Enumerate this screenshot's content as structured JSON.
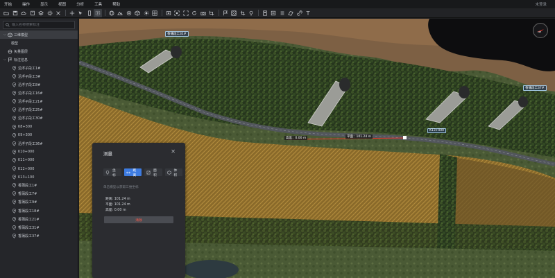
{
  "menubar": {
    "items": [
      "开始",
      "操作",
      "显示",
      "视图",
      "分析",
      "工具",
      "帮助"
    ],
    "login": "未登录"
  },
  "toolbar": {
    "icons": [
      "folder-icon",
      "save-icon",
      "cloud-icon",
      "settings-icon",
      "layers-icon",
      "gear-icon",
      "close-icon",
      "move-icon",
      "select-icon",
      "ruler-icon",
      "select-box-icon",
      "globe-icon",
      "terrain-icon",
      "target-icon",
      "cube-icon",
      "sun-icon",
      "grid-icon",
      "frame-icon",
      "zoom-fit-icon",
      "fullscreen-icon",
      "rotate-icon",
      "camera-icon",
      "screenshot-icon",
      "flag-icon",
      "pattern-icon",
      "crop-icon",
      "pin-icon",
      "book-icon",
      "archive-icon",
      "list-icon",
      "transform-icon",
      "link-icon",
      "text-icon"
    ]
  },
  "sidebar": {
    "search_placeholder": "输入名称搜索标注",
    "tree": [
      {
        "label": "三维模型",
        "level": 0,
        "caret": "⌵",
        "icon": "model-icon",
        "selected": true
      },
      {
        "label": "模型",
        "level": 1,
        "caret": "",
        "icon": "",
        "selected": false
      },
      {
        "label": "矢量图层",
        "level": 0,
        "caret": "",
        "icon": "vector-icon",
        "selected": false
      },
      {
        "label": "标注信息",
        "level": 0,
        "caret": "⌵",
        "icon": "annotation-icon",
        "selected": false
      },
      {
        "label": "沿浮子段工1#",
        "level": 1,
        "caret": "",
        "icon": "location-pin-icon",
        "selected": false
      },
      {
        "label": "沿浮子段工3#",
        "level": 1,
        "caret": "",
        "icon": "location-pin-icon",
        "selected": false
      },
      {
        "label": "沿浮子段工8#",
        "level": 1,
        "caret": "",
        "icon": "location-pin-icon",
        "selected": false
      },
      {
        "label": "沿浮子段工16#",
        "level": 1,
        "caret": "",
        "icon": "location-pin-icon",
        "selected": false
      },
      {
        "label": "沿浮子段工21#",
        "level": 1,
        "caret": "",
        "icon": "location-pin-icon",
        "selected": false
      },
      {
        "label": "沿浮子段工25#",
        "level": 1,
        "caret": "",
        "icon": "location-pin-icon",
        "selected": false
      },
      {
        "label": "沿浮子段工30#",
        "level": 1,
        "caret": "",
        "icon": "location-pin-icon",
        "selected": false
      },
      {
        "label": "K8+300",
        "level": 1,
        "caret": "",
        "icon": "location-pin-icon",
        "selected": false
      },
      {
        "label": "K9+300",
        "level": 1,
        "caret": "",
        "icon": "location-pin-icon",
        "selected": false
      },
      {
        "label": "沿浮子段工36#",
        "level": 1,
        "caret": "",
        "icon": "location-pin-icon",
        "selected": false
      },
      {
        "label": "K10+000",
        "level": 1,
        "caret": "",
        "icon": "location-pin-icon",
        "selected": false
      },
      {
        "label": "K11+000",
        "level": 1,
        "caret": "",
        "icon": "location-pin-icon",
        "selected": false
      },
      {
        "label": "K12+000",
        "level": 1,
        "caret": "",
        "icon": "location-pin-icon",
        "selected": false
      },
      {
        "label": "K13+100",
        "level": 1,
        "caret": "",
        "icon": "location-pin-icon",
        "selected": false
      },
      {
        "label": "香蒲段工1#",
        "level": 1,
        "caret": "",
        "icon": "location-pin-icon",
        "selected": false
      },
      {
        "label": "香蒲段工7#",
        "level": 1,
        "caret": "",
        "icon": "location-pin-icon",
        "selected": false
      },
      {
        "label": "香蒲段工9#",
        "level": 1,
        "caret": "",
        "icon": "location-pin-icon",
        "selected": false
      },
      {
        "label": "香蒲段工18#",
        "level": 1,
        "caret": "",
        "icon": "location-pin-icon",
        "selected": false
      },
      {
        "label": "香蒲段工21#",
        "level": 1,
        "caret": "",
        "icon": "location-pin-icon",
        "selected": false
      },
      {
        "label": "香蒲段工31#",
        "level": 1,
        "caret": "",
        "icon": "location-pin-icon",
        "selected": false
      },
      {
        "label": "香蒲段工37#",
        "level": 1,
        "caret": "",
        "icon": "location-pin-icon",
        "selected": false
      }
    ]
  },
  "map": {
    "labels": {
      "site_left": "香蒲段工31#",
      "site_right": "香蒲段工37#",
      "station": "K13+000"
    },
    "measure": {
      "height_label": "高差：0.00 m",
      "plane_label": "平面：101.24 m"
    }
  },
  "panel": {
    "title": "测量",
    "close": "✕",
    "tabs": [
      {
        "label": "坐标",
        "icon": "coordinate-icon",
        "active": false
      },
      {
        "label": "距离",
        "icon": "distance-icon",
        "active": true
      },
      {
        "label": "面积",
        "icon": "area-icon",
        "active": false
      },
      {
        "label": "体积",
        "icon": "volume-icon",
        "active": false
      }
    ],
    "hint": "单击模型以获取三维坐标",
    "results": [
      "距离: 101.24 m",
      "平面: 101.24 m",
      "高差: 0.00 m"
    ],
    "clear_label": "清除"
  },
  "colors": {
    "accent": "#3d7be0",
    "danger": "#ff5a4a",
    "measure_line": "#e0352b"
  }
}
